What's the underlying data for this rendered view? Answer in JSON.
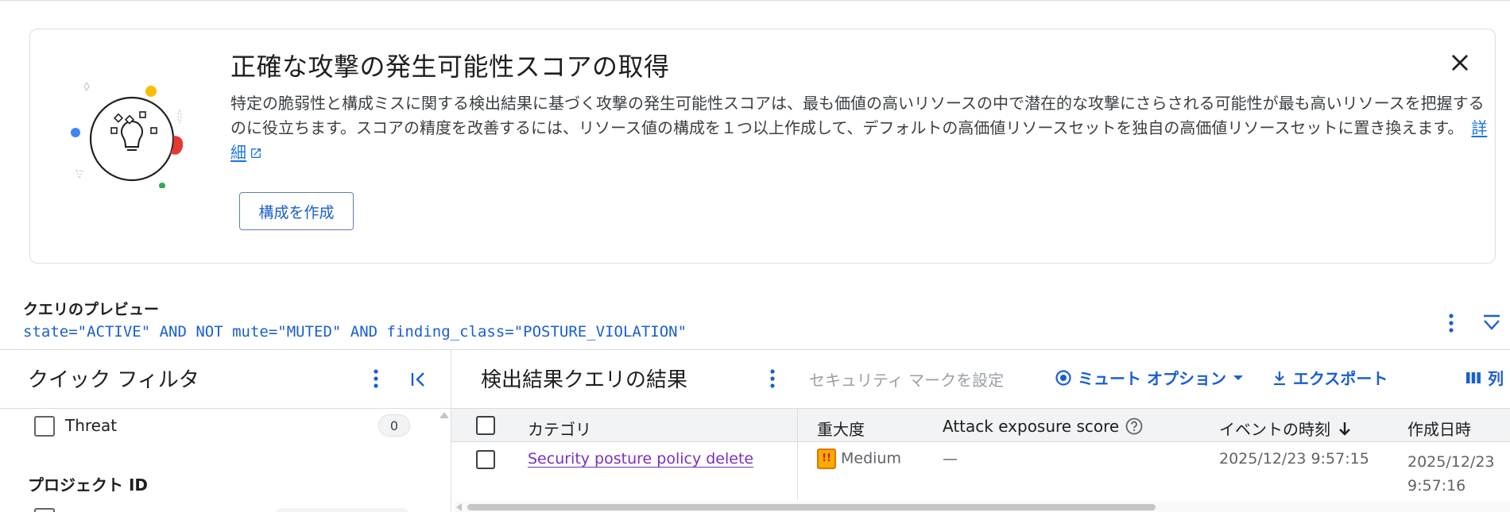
{
  "banner": {
    "title": "正確な攻撃の発生可能性スコアの取得",
    "body": "特定の脆弱性と構成ミスに関する検出結果に基づく攻撃の発生可能性スコアは、最も価値の高いリソースの中で潜在的な攻撃にさらされる可能性が最も高いリソースを把握するのに役立ちます。スコアの精度を改善するには、リソース値の構成を１つ以上作成して、デフォルトの高価値リソースセットを独自の高価値リソースセットに置き換えます。",
    "learn_more": "詳細",
    "create_button": "構成を作成",
    "icons": {
      "close": "close-icon",
      "external": "open-in-new-icon",
      "illustration": "lightbulb-illustration"
    }
  },
  "query_preview": {
    "label": "クエリのプレビュー",
    "query": "state=\"ACTIVE\" AND NOT mute=\"MUTED\" AND finding_class=\"POSTURE_VIOLATION\""
  },
  "quick_filters": {
    "title": "クイック フィルタ",
    "items": [
      {
        "label": "Threat",
        "count": "0"
      }
    ],
    "section_project": "プロジェクト ID"
  },
  "results": {
    "title": "検出結果クエリの結果",
    "toolbar": {
      "security_mark": "セキュリティ マークを設定",
      "mute_options": "ミュート オプション",
      "export": "エクスポート",
      "columns": "列"
    },
    "columns": [
      "カテゴリ",
      "重大度",
      "Attack exposure score",
      "イベントの時刻",
      "作成日時"
    ],
    "rows": [
      {
        "category": "Security posture policy delete",
        "severity": "Medium",
        "severity_icon_text": "!!",
        "attack_exposure": "—",
        "event_time": "2025/12/23 9:57:15",
        "create_time_date": "2025/12/23",
        "create_time_time": "9:57:16"
      }
    ]
  },
  "colors": {
    "accent": "#1a5fd0",
    "link_visited": "#7b2fbf",
    "severity_medium": "#f9ab00",
    "illus_red": "#e53935",
    "illus_blue": "#4285f4",
    "illus_yellow": "#fbbc04",
    "illus_green": "#34a853"
  }
}
